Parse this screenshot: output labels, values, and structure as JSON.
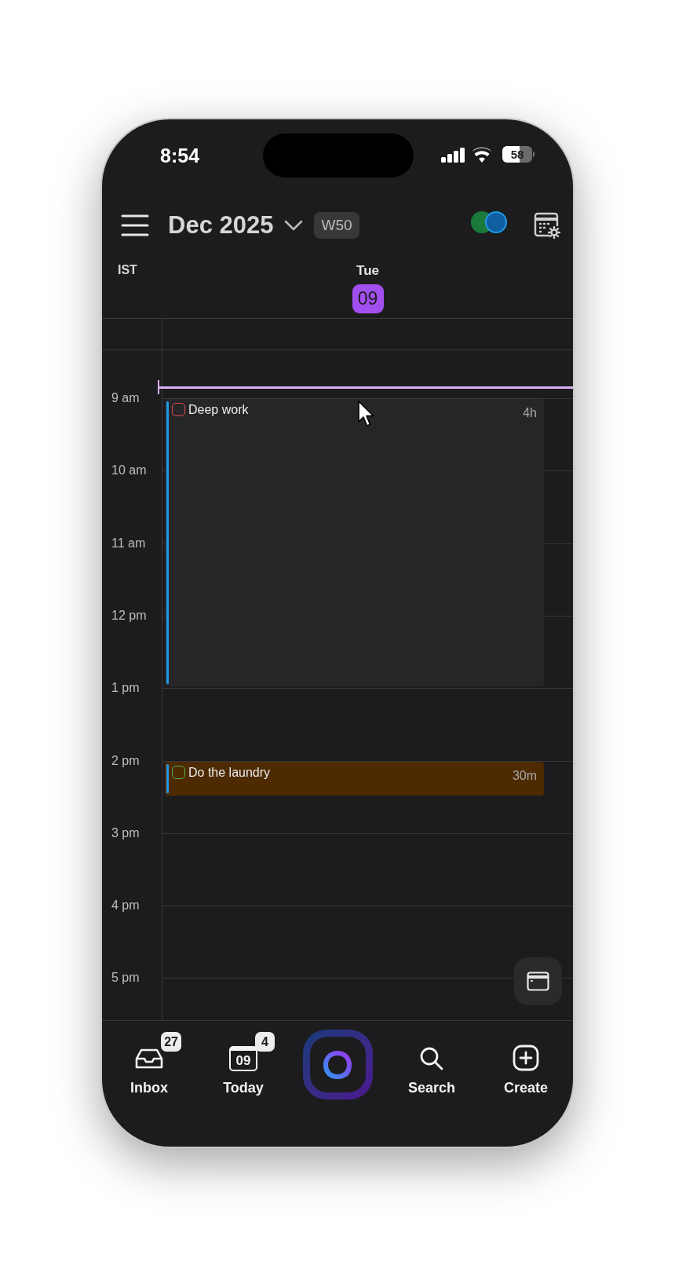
{
  "status_bar": {
    "time": "8:54",
    "battery": {
      "text": "58",
      "level": 0.58
    }
  },
  "header": {
    "title": "Dec 2025",
    "week": "W50",
    "accounts": [
      {
        "color": "#1a7a3c"
      },
      {
        "color": "#0f5fa0"
      }
    ]
  },
  "day_header": {
    "timezone": "IST",
    "weekday": "Tue",
    "date": "09",
    "selected": true
  },
  "hours": [
    {
      "label": "9 am",
      "events": [
        {
          "title": "Deep work",
          "duration": "4h",
          "color": "#262628",
          "checkbox": {
            "color": "#e04848"
          }
        }
      ]
    },
    {
      "label": "10 am"
    },
    {
      "label": "11 am"
    },
    {
      "label": "12 pm"
    },
    {
      "label": "1 pm"
    },
    {
      "label": "2 pm",
      "events": [
        {
          "title": "Do the laundry",
          "duration": "30m",
          "color": "#4d2a02",
          "checkbox": {
            "color": "#4cb050"
          }
        }
      ]
    },
    {
      "label": "3 pm"
    },
    {
      "label": "4 pm"
    },
    {
      "label": "5 pm"
    }
  ],
  "bottom_nav": [
    {
      "kind": "inbox",
      "label": "Inbox",
      "badge": "27"
    },
    {
      "kind": "today",
      "label": "Today",
      "badge": "4",
      "icon_text": "09"
    },
    {
      "kind": "app"
    },
    {
      "kind": "search",
      "label": "Search"
    },
    {
      "kind": "create",
      "label": "Create"
    }
  ]
}
